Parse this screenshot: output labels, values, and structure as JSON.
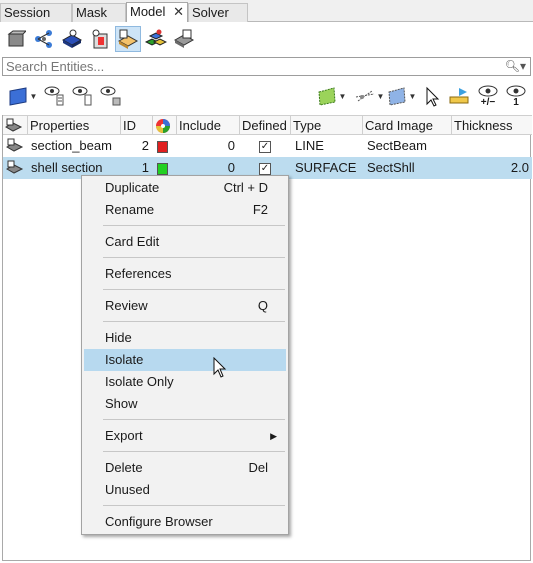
{
  "tabs": [
    {
      "label": "Session"
    },
    {
      "label": "Mask"
    },
    {
      "label": "Model",
      "close": "✕"
    },
    {
      "label": "Solver"
    }
  ],
  "search": {
    "placeholder": "Search Entities..."
  },
  "table": {
    "columns": [
      "Properties",
      "ID",
      "",
      "Include",
      "Defined",
      "Type",
      "Card Image",
      "Thickness"
    ],
    "rows": [
      {
        "name": "section_beam",
        "id": "2",
        "color": "#e02020",
        "include": "0",
        "defined": "✓",
        "type": "LINE",
        "card_image": "SectBeam",
        "thickness": ""
      },
      {
        "name": "shell section",
        "id": "1",
        "color": "#22d022",
        "include": "0",
        "defined": "✓",
        "type": "SURFACE",
        "card_image": "SectShll",
        "thickness": "2.0"
      }
    ]
  },
  "context_menu": {
    "duplicate": "Duplicate",
    "duplicate_sc": "Ctrl + D",
    "rename": "Rename",
    "rename_sc": "F2",
    "card_edit": "Card Edit",
    "references": "References",
    "review": "Review",
    "review_sc": "Q",
    "hide": "Hide",
    "isolate": "Isolate",
    "isolate_only": "Isolate Only",
    "show": "Show",
    "export": "Export",
    "delete": "Delete",
    "delete_sc": "Del",
    "unused": "Unused",
    "configure": "Configure Browser"
  },
  "toolbar2": {
    "plus_minus": "+/−",
    "one": "1"
  },
  "colors": {
    "selection": "#bcdcef",
    "menu_highlight": "#b7d9ef"
  }
}
